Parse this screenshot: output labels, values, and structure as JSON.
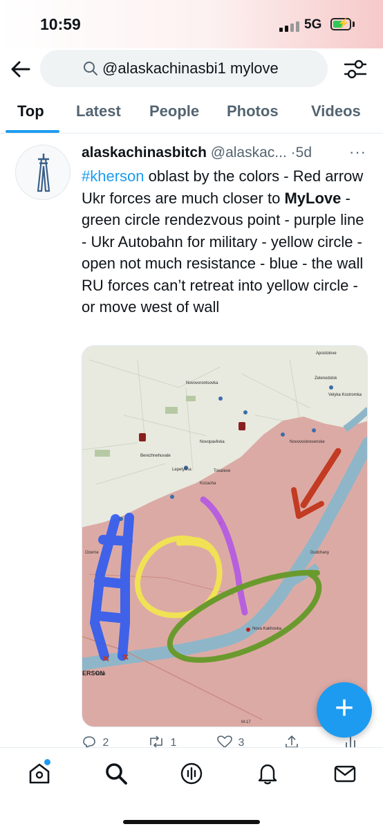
{
  "status_bar": {
    "time": "10:59",
    "network": "5G",
    "battery_charging": true
  },
  "search": {
    "query": "@alaskachinasbi1 mylove"
  },
  "tabs": [
    {
      "label": "Top",
      "active": true
    },
    {
      "label": "Latest"
    },
    {
      "label": "People"
    },
    {
      "label": "Photos"
    },
    {
      "label": "Videos"
    }
  ],
  "tweet": {
    "author_name": "alaskachinasbitch",
    "handle": "@alaskac...",
    "dot": "·",
    "time": "5d",
    "more": "···",
    "text": {
      "hashtag": "#kherson",
      "part1": " oblast by the colors - Red arrow Ukr forces are much closer to ",
      "bold": "MyLove",
      "part2": " - green circle rendezvous point - purple line - Ukr Autobahn for military - yellow circle - open not much resistance - blue - the wall RU forces can’t retreat into yellow circle - or move west of wall"
    },
    "map_labels": {
      "kherson": "ERSON",
      "nova_kakhovka": "Nova Kakhovka",
      "apostolove": "Apostolove",
      "novovorontsovka": "Novovorontsovka",
      "berezhnehuvate": "Berezhnehuvate",
      "novopavlivka": "Novopavlivka",
      "lepetykha": "Lepetykha",
      "tokareve": "Tokareve",
      "novovoskresenske": "Novovoskresenske",
      "dudchany": "Dudchany",
      "kozacha": "Kozacha",
      "velyka_kostromka": "Velyka Kostromka",
      "zelenodolsk": "Zelenodolsk",
      "ozerne": "Ozerne",
      "m14": "M-14",
      "m17": "M-17"
    },
    "actions": {
      "replies": "2",
      "retweets": "1",
      "likes": "3"
    }
  },
  "fab": {
    "label": "+"
  },
  "colors": {
    "accent": "#1d9bf0",
    "occupied_area": "#dcaaa5",
    "free_area": "#e8eadf",
    "river": "#8fb6c8",
    "arrow_red": "#c23b22",
    "circle_green": "#6a9a2e",
    "line_purple": "#b45ce0",
    "circle_yellow": "#f0e254",
    "wall_blue": "#2f5bf0"
  },
  "nav": [
    "home-icon",
    "search-icon",
    "spaces-icon",
    "notifications-icon",
    "messages-icon"
  ]
}
